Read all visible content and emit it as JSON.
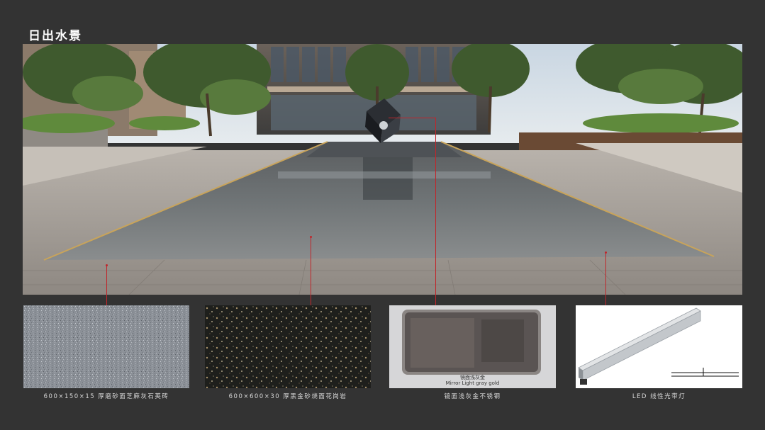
{
  "page": {
    "title": "日出水景",
    "background": "#333333",
    "accent": "#c0262b"
  },
  "render_image": {
    "icon": "landscape-render-water-feature"
  },
  "materials": [
    {
      "caption": "600×150×15 厚磨砂面芝麻灰石英砖",
      "swatch": "grey-granite-texture"
    },
    {
      "caption": "600×600×30 厚黑金砂烧面花岗岩",
      "swatch": "black-gold-sand-granite"
    },
    {
      "caption": "镜面浅灰金不锈钢",
      "swatch": "mirror-light-gray-gold-steel",
      "inset_label_cn": "镜面浅灰金",
      "inset_label_en": "Mirror Light gray gold"
    },
    {
      "caption": "LED 线性光带灯",
      "swatch": "led-linear-light-strip"
    }
  ]
}
